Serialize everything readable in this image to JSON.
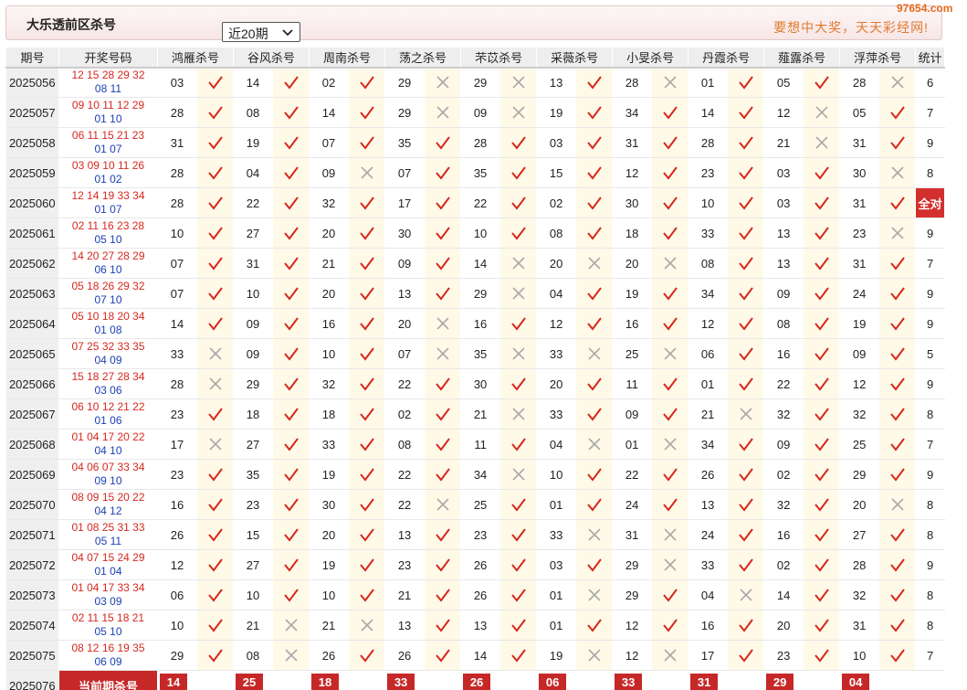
{
  "header": {
    "title": "大乐透前区杀号",
    "period_select": "近20期",
    "slogan": "要想中大奖，天天彩经网!",
    "watermark": "97654.com"
  },
  "columns": [
    "期号",
    "开奖号码",
    "鸿雁杀号",
    "谷风杀号",
    "周南杀号",
    "荡之杀号",
    "芣苡杀号",
    "采薇杀号",
    "小旻杀号",
    "丹霞杀号",
    "薤露杀号",
    "浮萍杀号",
    "统计"
  ],
  "rows": [
    {
      "period": "2025056",
      "front": "12 15 28 29 32",
      "back": "08 11",
      "kills": [
        [
          "03",
          "ok"
        ],
        [
          "14",
          "ok"
        ],
        [
          "02",
          "ok"
        ],
        [
          "29",
          "x"
        ],
        [
          "29",
          "x"
        ],
        [
          "13",
          "ok"
        ],
        [
          "28",
          "x"
        ],
        [
          "01",
          "ok"
        ],
        [
          "05",
          "ok"
        ],
        [
          "28",
          "x"
        ]
      ],
      "stat": "6"
    },
    {
      "period": "2025057",
      "front": "09 10 11 12 29",
      "back": "01 10",
      "kills": [
        [
          "28",
          "ok"
        ],
        [
          "08",
          "ok"
        ],
        [
          "14",
          "ok"
        ],
        [
          "29",
          "x"
        ],
        [
          "09",
          "x"
        ],
        [
          "19",
          "ok"
        ],
        [
          "34",
          "ok"
        ],
        [
          "14",
          "ok"
        ],
        [
          "12",
          "x"
        ],
        [
          "05",
          "ok"
        ]
      ],
      "stat": "7"
    },
    {
      "period": "2025058",
      "front": "06 11 15 21 23",
      "back": "01 07",
      "kills": [
        [
          "31",
          "ok"
        ],
        [
          "19",
          "ok"
        ],
        [
          "07",
          "ok"
        ],
        [
          "35",
          "ok"
        ],
        [
          "28",
          "ok"
        ],
        [
          "03",
          "ok"
        ],
        [
          "31",
          "ok"
        ],
        [
          "28",
          "ok"
        ],
        [
          "21",
          "x"
        ],
        [
          "31",
          "ok"
        ]
      ],
      "stat": "9"
    },
    {
      "period": "2025059",
      "front": "03 09 10 11 26",
      "back": "01 02",
      "kills": [
        [
          "28",
          "ok"
        ],
        [
          "04",
          "ok"
        ],
        [
          "09",
          "x"
        ],
        [
          "07",
          "ok"
        ],
        [
          "35",
          "ok"
        ],
        [
          "15",
          "ok"
        ],
        [
          "12",
          "ok"
        ],
        [
          "23",
          "ok"
        ],
        [
          "03",
          "ok"
        ],
        [
          "30",
          "x"
        ]
      ],
      "stat": "8"
    },
    {
      "period": "2025060",
      "front": "12 14 19 33 34",
      "back": "01 07",
      "kills": [
        [
          "28",
          "ok"
        ],
        [
          "22",
          "ok"
        ],
        [
          "32",
          "ok"
        ],
        [
          "17",
          "ok"
        ],
        [
          "22",
          "ok"
        ],
        [
          "02",
          "ok"
        ],
        [
          "30",
          "ok"
        ],
        [
          "10",
          "ok"
        ],
        [
          "03",
          "ok"
        ],
        [
          "31",
          "ok"
        ]
      ],
      "stat": "全对"
    },
    {
      "period": "2025061",
      "front": "02 11 16 23 28",
      "back": "05 10",
      "kills": [
        [
          "10",
          "ok"
        ],
        [
          "27",
          "ok"
        ],
        [
          "20",
          "ok"
        ],
        [
          "30",
          "ok"
        ],
        [
          "10",
          "ok"
        ],
        [
          "08",
          "ok"
        ],
        [
          "18",
          "ok"
        ],
        [
          "33",
          "ok"
        ],
        [
          "13",
          "ok"
        ],
        [
          "23",
          "x"
        ]
      ],
      "stat": "9"
    },
    {
      "period": "2025062",
      "front": "14 20 27 28 29",
      "back": "06 10",
      "kills": [
        [
          "07",
          "ok"
        ],
        [
          "31",
          "ok"
        ],
        [
          "21",
          "ok"
        ],
        [
          "09",
          "ok"
        ],
        [
          "14",
          "x"
        ],
        [
          "20",
          "x"
        ],
        [
          "20",
          "x"
        ],
        [
          "08",
          "ok"
        ],
        [
          "13",
          "ok"
        ],
        [
          "31",
          "ok"
        ]
      ],
      "stat": "7"
    },
    {
      "period": "2025063",
      "front": "05 18 26 29 32",
      "back": "07 10",
      "kills": [
        [
          "07",
          "ok"
        ],
        [
          "10",
          "ok"
        ],
        [
          "20",
          "ok"
        ],
        [
          "13",
          "ok"
        ],
        [
          "29",
          "x"
        ],
        [
          "04",
          "ok"
        ],
        [
          "19",
          "ok"
        ],
        [
          "34",
          "ok"
        ],
        [
          "09",
          "ok"
        ],
        [
          "24",
          "ok"
        ]
      ],
      "stat": "9"
    },
    {
      "period": "2025064",
      "front": "05 10 18 20 34",
      "back": "01 08",
      "kills": [
        [
          "14",
          "ok"
        ],
        [
          "09",
          "ok"
        ],
        [
          "16",
          "ok"
        ],
        [
          "20",
          "x"
        ],
        [
          "16",
          "ok"
        ],
        [
          "12",
          "ok"
        ],
        [
          "16",
          "ok"
        ],
        [
          "12",
          "ok"
        ],
        [
          "08",
          "ok"
        ],
        [
          "19",
          "ok"
        ]
      ],
      "stat": "9"
    },
    {
      "period": "2025065",
      "front": "07 25 32 33 35",
      "back": "04 09",
      "kills": [
        [
          "33",
          "x"
        ],
        [
          "09",
          "ok"
        ],
        [
          "10",
          "ok"
        ],
        [
          "07",
          "x"
        ],
        [
          "35",
          "x"
        ],
        [
          "33",
          "x"
        ],
        [
          "25",
          "x"
        ],
        [
          "06",
          "ok"
        ],
        [
          "16",
          "ok"
        ],
        [
          "09",
          "ok"
        ]
      ],
      "stat": "5"
    },
    {
      "period": "2025066",
      "front": "15 18 27 28 34",
      "back": "03 06",
      "kills": [
        [
          "28",
          "x"
        ],
        [
          "29",
          "ok"
        ],
        [
          "32",
          "ok"
        ],
        [
          "22",
          "ok"
        ],
        [
          "30",
          "ok"
        ],
        [
          "20",
          "ok"
        ],
        [
          "11",
          "ok"
        ],
        [
          "01",
          "ok"
        ],
        [
          "22",
          "ok"
        ],
        [
          "12",
          "ok"
        ]
      ],
      "stat": "9"
    },
    {
      "period": "2025067",
      "front": "06 10 12 21 22",
      "back": "01 06",
      "kills": [
        [
          "23",
          "ok"
        ],
        [
          "18",
          "ok"
        ],
        [
          "18",
          "ok"
        ],
        [
          "02",
          "ok"
        ],
        [
          "21",
          "x"
        ],
        [
          "33",
          "ok"
        ],
        [
          "09",
          "ok"
        ],
        [
          "21",
          "x"
        ],
        [
          "32",
          "ok"
        ],
        [
          "32",
          "ok"
        ]
      ],
      "stat": "8"
    },
    {
      "period": "2025068",
      "front": "01 04 17 20 22",
      "back": "04 10",
      "kills": [
        [
          "17",
          "x"
        ],
        [
          "27",
          "ok"
        ],
        [
          "33",
          "ok"
        ],
        [
          "08",
          "ok"
        ],
        [
          "11",
          "ok"
        ],
        [
          "04",
          "x"
        ],
        [
          "01",
          "x"
        ],
        [
          "34",
          "ok"
        ],
        [
          "09",
          "ok"
        ],
        [
          "25",
          "ok"
        ]
      ],
      "stat": "7"
    },
    {
      "period": "2025069",
      "front": "04 06 07 33 34",
      "back": "09 10",
      "kills": [
        [
          "23",
          "ok"
        ],
        [
          "35",
          "ok"
        ],
        [
          "19",
          "ok"
        ],
        [
          "22",
          "ok"
        ],
        [
          "34",
          "x"
        ],
        [
          "10",
          "ok"
        ],
        [
          "22",
          "ok"
        ],
        [
          "26",
          "ok"
        ],
        [
          "02",
          "ok"
        ],
        [
          "29",
          "ok"
        ]
      ],
      "stat": "9"
    },
    {
      "period": "2025070",
      "front": "08 09 15 20 22",
      "back": "04 12",
      "kills": [
        [
          "16",
          "ok"
        ],
        [
          "23",
          "ok"
        ],
        [
          "30",
          "ok"
        ],
        [
          "22",
          "x"
        ],
        [
          "25",
          "ok"
        ],
        [
          "01",
          "ok"
        ],
        [
          "24",
          "ok"
        ],
        [
          "13",
          "ok"
        ],
        [
          "32",
          "ok"
        ],
        [
          "20",
          "x"
        ]
      ],
      "stat": "8"
    },
    {
      "period": "2025071",
      "front": "01 08 25 31 33",
      "back": "05 11",
      "kills": [
        [
          "26",
          "ok"
        ],
        [
          "15",
          "ok"
        ],
        [
          "20",
          "ok"
        ],
        [
          "13",
          "ok"
        ],
        [
          "23",
          "ok"
        ],
        [
          "33",
          "x"
        ],
        [
          "31",
          "x"
        ],
        [
          "24",
          "ok"
        ],
        [
          "16",
          "ok"
        ],
        [
          "27",
          "ok"
        ]
      ],
      "stat": "8"
    },
    {
      "period": "2025072",
      "front": "04 07 15 24 29",
      "back": "01 04",
      "kills": [
        [
          "12",
          "ok"
        ],
        [
          "27",
          "ok"
        ],
        [
          "19",
          "ok"
        ],
        [
          "23",
          "ok"
        ],
        [
          "26",
          "ok"
        ],
        [
          "03",
          "ok"
        ],
        [
          "29",
          "x"
        ],
        [
          "33",
          "ok"
        ],
        [
          "02",
          "ok"
        ],
        [
          "28",
          "ok"
        ]
      ],
      "stat": "9"
    },
    {
      "period": "2025073",
      "front": "01 04 17 33 34",
      "back": "03 09",
      "kills": [
        [
          "06",
          "ok"
        ],
        [
          "10",
          "ok"
        ],
        [
          "10",
          "ok"
        ],
        [
          "21",
          "ok"
        ],
        [
          "26",
          "ok"
        ],
        [
          "01",
          "x"
        ],
        [
          "29",
          "ok"
        ],
        [
          "04",
          "x"
        ],
        [
          "14",
          "ok"
        ],
        [
          "32",
          "ok"
        ]
      ],
      "stat": "8"
    },
    {
      "period": "2025074",
      "front": "02 11 15 18 21",
      "back": "05 10",
      "kills": [
        [
          "10",
          "ok"
        ],
        [
          "21",
          "x"
        ],
        [
          "21",
          "x"
        ],
        [
          "13",
          "ok"
        ],
        [
          "13",
          "ok"
        ],
        [
          "01",
          "ok"
        ],
        [
          "12",
          "ok"
        ],
        [
          "16",
          "ok"
        ],
        [
          "20",
          "ok"
        ],
        [
          "31",
          "ok"
        ]
      ],
      "stat": "8"
    },
    {
      "period": "2025075",
      "front": "08 12 16 19 35",
      "back": "06 09",
      "kills": [
        [
          "29",
          "ok"
        ],
        [
          "08",
          "x"
        ],
        [
          "26",
          "ok"
        ],
        [
          "26",
          "ok"
        ],
        [
          "14",
          "ok"
        ],
        [
          "19",
          "x"
        ],
        [
          "12",
          "x"
        ],
        [
          "17",
          "ok"
        ],
        [
          "23",
          "ok"
        ],
        [
          "10",
          "ok"
        ]
      ],
      "stat": "7"
    }
  ],
  "current": {
    "period": "2025076",
    "label": "当前期杀号",
    "kills": [
      "14",
      "25",
      "18",
      "33",
      "26",
      "06",
      "33",
      "31",
      "29",
      "04"
    ]
  },
  "colors": {
    "check": "#d6281d",
    "cross": "#a9a9a9",
    "front": "#d6281d",
    "back": "#1b3fb5",
    "highlight": "#c62828"
  }
}
